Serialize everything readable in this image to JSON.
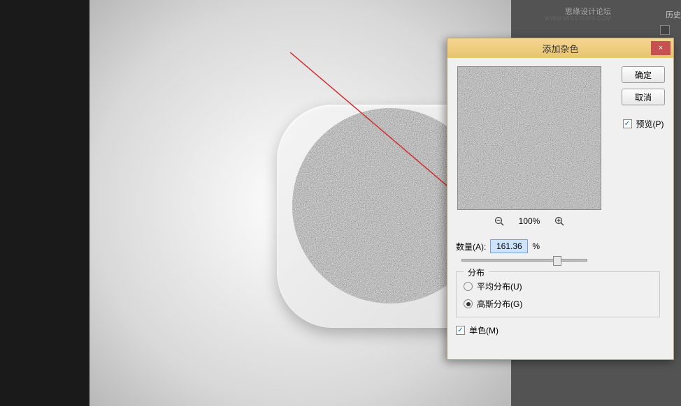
{
  "watermark": {
    "main": "思缘设计论坛",
    "sub": "WWW.MISSYUAN.COM"
  },
  "panel": {
    "tab": "历史"
  },
  "dialog": {
    "title": "添加杂色",
    "close_icon": "×"
  },
  "buttons": {
    "ok": "确定",
    "cancel": "取消",
    "preview": "预览(P)"
  },
  "zoom": {
    "percent": "100%"
  },
  "amount": {
    "label": "数量(A):",
    "value": "161.36",
    "unit": "%"
  },
  "distribution": {
    "legend": "分布",
    "uniform": "平均分布(U)",
    "gaussian": "高斯分布(G)"
  },
  "monochrome": {
    "label": "单色(M)"
  }
}
